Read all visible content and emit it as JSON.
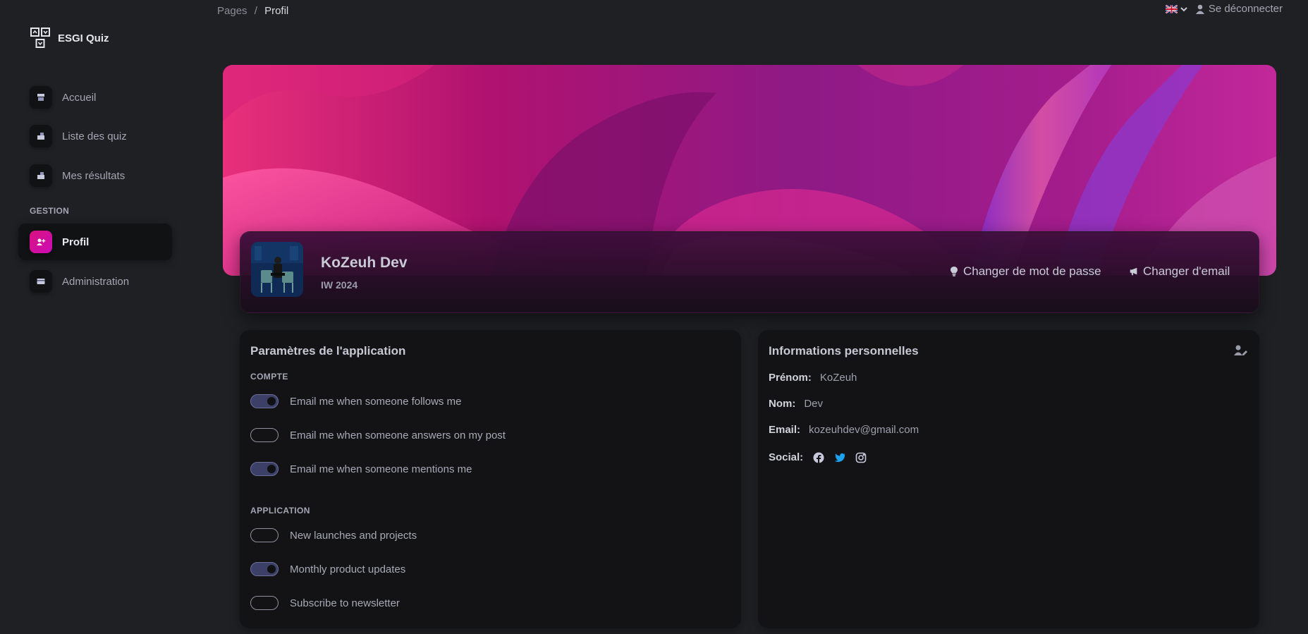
{
  "brand": {
    "name": "ESGI Quiz",
    "icon": "quiz-logo-icon"
  },
  "sidebar": {
    "items": [
      {
        "label": "Accueil",
        "icon": "shop-icon"
      },
      {
        "label": "Liste des quiz",
        "icon": "building-icon"
      },
      {
        "label": "Mes résultats",
        "icon": "building-icon"
      }
    ],
    "section_label": "GESTION",
    "gestion_items": [
      {
        "label": "Profil",
        "icon": "user-plus-icon",
        "active": true
      },
      {
        "label": "Administration",
        "icon": "credit-card-icon"
      }
    ]
  },
  "breadcrumb": {
    "root": "Pages",
    "separator": "/",
    "current": "Profil"
  },
  "topbar": {
    "language_icon": "uk-flag-icon",
    "logout_label": "Se déconnecter"
  },
  "profile": {
    "name": "KoZeuh Dev",
    "subtitle": "IW 2024",
    "actions": [
      {
        "label": "Changer de mot de passe",
        "icon": "lightbulb-icon"
      },
      {
        "label": "Changer d'email",
        "icon": "bullhorn-icon"
      }
    ]
  },
  "settings": {
    "title": "Paramètres de l'application",
    "groups": [
      {
        "label": "COMPTE",
        "toggles": [
          {
            "label": "Email me when someone follows me",
            "on": true
          },
          {
            "label": "Email me when someone answers on my post",
            "on": false
          },
          {
            "label": "Email me when someone mentions me",
            "on": true
          }
        ]
      },
      {
        "label": "APPLICATION",
        "toggles": [
          {
            "label": "New launches and projects",
            "on": false
          },
          {
            "label": "Monthly product updates",
            "on": true
          },
          {
            "label": "Subscribe to newsletter",
            "on": false
          }
        ]
      }
    ]
  },
  "info": {
    "title": "Informations personnelles",
    "fields": {
      "firstname": {
        "label": "Prénom:",
        "value": "KoZeuh"
      },
      "lastname": {
        "label": "Nom:",
        "value": "Dev"
      },
      "email": {
        "label": "Email:",
        "value": "kozeuhdev@gmail.com"
      },
      "social": {
        "label": "Social:"
      }
    },
    "social_icons": [
      "facebook-icon",
      "twitter-icon",
      "instagram-icon"
    ]
  },
  "colors": {
    "background": "#1f2023",
    "card": "#131315",
    "accent": "#cb0c9f",
    "twitter": "#1da1f2",
    "switch_on": "#3c3f66"
  }
}
